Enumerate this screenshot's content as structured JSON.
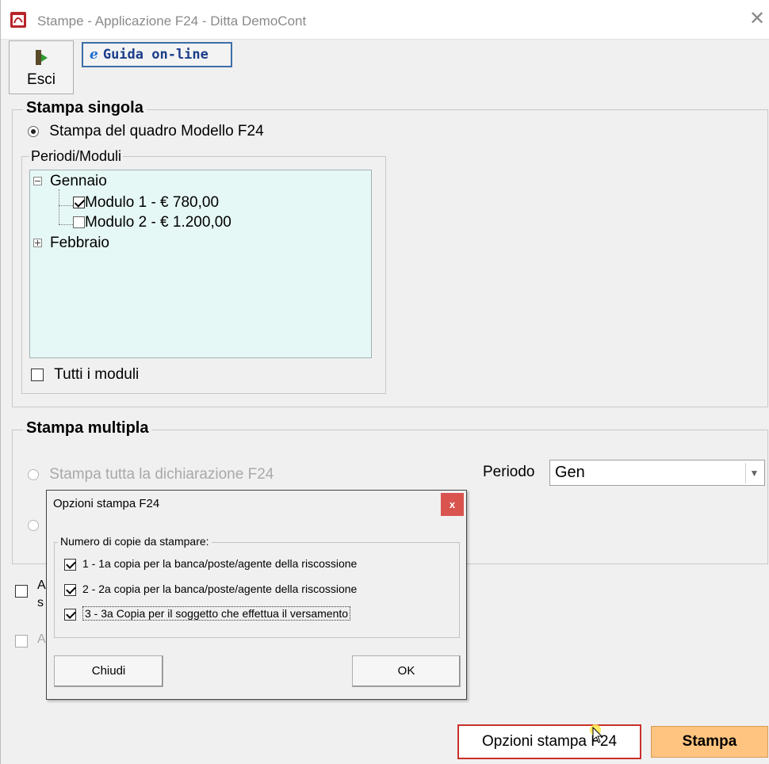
{
  "window": {
    "title": "Stampe - Applicazione F24 - Ditta  DemoCont",
    "close": "✕"
  },
  "toolbar": {
    "esci_label": "Esci",
    "guida_label": "Guida on-line",
    "guida_icon": "ie-icon"
  },
  "stampa_singola": {
    "title": "Stampa singola",
    "radio_label": "Stampa del quadro Modello F24",
    "periodi_title": "Periodi/Moduli",
    "tree": {
      "gennaio": "Gennaio",
      "modulo1": "Modulo 1 - € 780,00",
      "modulo1_checked": true,
      "modulo2": "Modulo 2 - € 1.200,00",
      "modulo2_checked": false,
      "febbraio": "Febbraio"
    },
    "tutti_label": "Tutti i moduli"
  },
  "stampa_multipla": {
    "title": "Stampa multipla",
    "radio1_label": "Stampa tutta la dichiarazione F24",
    "periodo_label": "Periodo",
    "periodo_value": "Gen"
  },
  "bottom_checks": {
    "check1_partial": "A",
    "check1_partial2": "s",
    "check2_partial": "A"
  },
  "dialog": {
    "title": "Opzioni stampa F24",
    "close": "x",
    "group_title": "Numero di copie da stampare:",
    "options": [
      {
        "label": "1 - 1a copia per la banca/poste/agente della riscossione",
        "checked": true
      },
      {
        "label": "2 - 2a copia per la banca/poste/agente della riscossione",
        "checked": true
      },
      {
        "label": "3 - 3a Copia per il soggetto che effettua il versamento",
        "checked": true
      }
    ],
    "chiudi": "Chiudi",
    "ok": "OK"
  },
  "footer": {
    "opzioni_label": "Opzioni stampa F24",
    "stampa_label": "Stampa"
  },
  "colors": {
    "tree_bg": "#e6f8f5",
    "stampa_bg": "#ffc47f",
    "highlight_border": "#c9302c"
  }
}
